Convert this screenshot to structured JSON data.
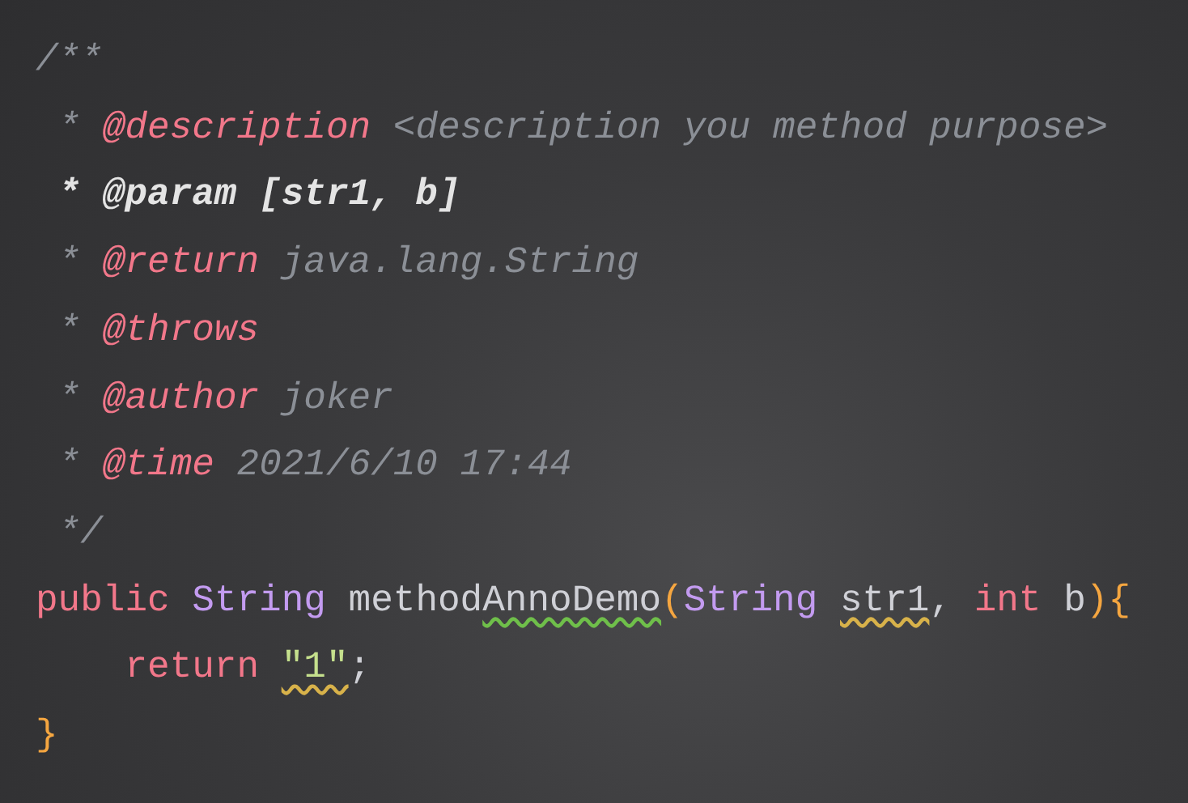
{
  "editor": {
    "lines": [
      {
        "tokens": [
          {
            "kind": "comment",
            "text": "/**"
          }
        ]
      },
      {
        "tokens": [
          {
            "kind": "comment",
            "text": " *"
          },
          {
            "kind": "doc_tag",
            "text": " @description"
          },
          {
            "kind": "comment",
            "text": " <description you method purpose>"
          }
        ]
      },
      {
        "tokens": [
          {
            "kind": "doc_param",
            "text": " * @param [str1, b]"
          }
        ]
      },
      {
        "tokens": [
          {
            "kind": "comment",
            "text": " *"
          },
          {
            "kind": "doc_tag",
            "text": " @return"
          },
          {
            "kind": "comment",
            "text": " java.lang.String"
          }
        ]
      },
      {
        "tokens": [
          {
            "kind": "comment",
            "text": " *"
          },
          {
            "kind": "doc_tag",
            "text": " @throws"
          }
        ]
      },
      {
        "tokens": [
          {
            "kind": "comment",
            "text": " *"
          },
          {
            "kind": "doc_tag",
            "text": " @author"
          },
          {
            "kind": "comment",
            "text": " joker"
          }
        ]
      },
      {
        "tokens": [
          {
            "kind": "comment",
            "text": " *"
          },
          {
            "kind": "doc_tag",
            "text": " @time"
          },
          {
            "kind": "comment",
            "text": " 2021/6/10 17:44"
          }
        ]
      },
      {
        "tokens": [
          {
            "kind": "comment",
            "text": " */"
          }
        ]
      },
      {
        "tokens": [
          {
            "kind": "keyword",
            "text": "public",
            "typo": false,
            "warning": false
          },
          {
            "kind": "type",
            "text": " String",
            "typo": false,
            "warning": false
          },
          {
            "kind": "method",
            "parts": [
              {
                "text": " method",
                "typo": false,
                "warning": false
              },
              {
                "text": "AnnoDemo",
                "typo": true,
                "warning": false
              }
            ]
          },
          {
            "kind": "paren",
            "text": "(",
            "typo": false,
            "warning": false
          },
          {
            "kind": "type",
            "text": "String",
            "typo": false,
            "warning": false
          },
          {
            "kind": "plain",
            "text": " str1",
            "typo": false,
            "warning": true
          },
          {
            "kind": "plain",
            "text": ",",
            "typo": false,
            "warning": false
          },
          {
            "kind": "keyword",
            "text": " int",
            "typo": false,
            "warning": false
          },
          {
            "kind": "plain",
            "text": " b",
            "typo": false,
            "warning": false
          },
          {
            "kind": "paren",
            "text": ")",
            "typo": false,
            "warning": false
          },
          {
            "kind": "brace",
            "text": "{",
            "typo": false,
            "warning": false
          }
        ]
      },
      {
        "tokens": [
          {
            "kind": "keyword",
            "text": "    return",
            "typo": false,
            "warning": false
          },
          {
            "kind": "string",
            "text": " \"1\"",
            "typo": false,
            "warning": true
          },
          {
            "kind": "plain",
            "text": ";",
            "typo": false,
            "warning": false
          }
        ]
      },
      {
        "tokens": [
          {
            "kind": "brace",
            "text": "}"
          }
        ]
      }
    ]
  }
}
